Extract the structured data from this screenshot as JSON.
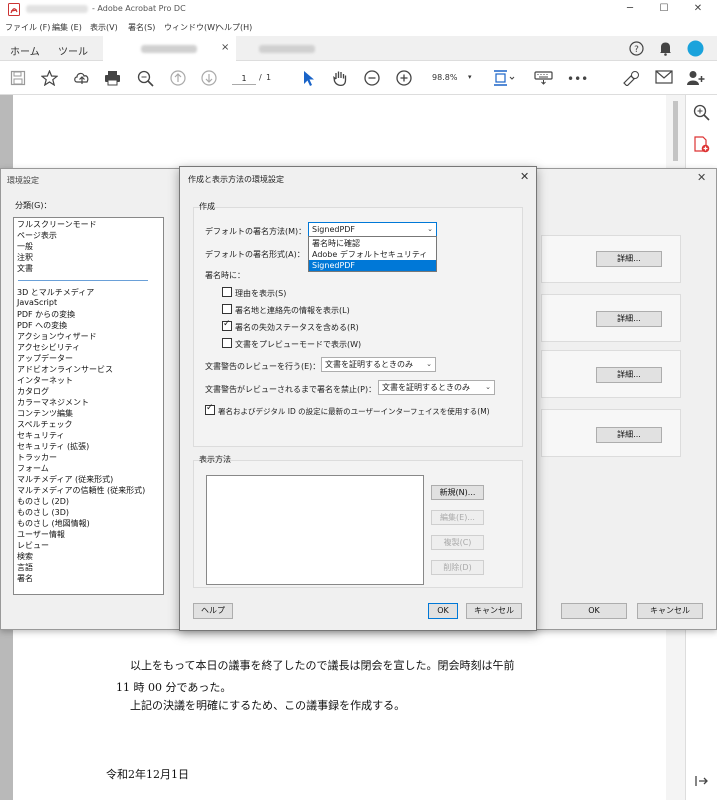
{
  "window": {
    "app_name": "- Adobe Acrobat Pro DC",
    "minimize": "─",
    "maximize": "☐",
    "close": "✕"
  },
  "menu": [
    "ファイル (F)",
    "編集 (E)",
    "表示(V)",
    "署名(S)",
    "ウィンドウ(W)",
    "ヘルプ(H)"
  ],
  "tabs": {
    "home": "ホーム",
    "tools": "ツール",
    "close": "×"
  },
  "toolbar": {
    "page_current": "1",
    "page_sep": "/",
    "page_total": "1",
    "zoom": "98.8%"
  },
  "document": {
    "lines": [
      "以上をもって本日の議事を終了したので議長は閉会を宣した。閉会時刻は午前",
      "11 時 00 分であった。",
      "上記の決議を明確にするため、この議事録を作成する。",
      "令和2年12月1日"
    ]
  },
  "preferences": {
    "title": "環境設定",
    "close": "✕",
    "category_label": "分類(G)：",
    "categories_top": [
      "フルスクリーンモード",
      "ページ表示",
      "一般",
      "注釈",
      "文書"
    ],
    "categories": [
      "3D とマルチメディア",
      "JavaScript",
      "PDF からの変換",
      "PDF への変換",
      "アクションウィザード",
      "アクセシビリティ",
      "アップデーター",
      "アドビオンラインサービス",
      "インターネット",
      "カタログ",
      "カラーマネジメント",
      "コンテンツ編集",
      "スペルチェック",
      "セキュリティ",
      "セキュリティ (拡張)",
      "トラッカー",
      "フォーム",
      "マルチメディア (従来形式)",
      "マルチメディアの信頼性 (従来形式)",
      "ものさし (2D)",
      "ものさし (3D)",
      "ものさし (地図情報)",
      "ユーザー情報",
      "レビュー",
      "検索",
      "言語",
      "署名"
    ],
    "detail_button": "詳細...",
    "ok": "OK",
    "cancel": "キャンセル"
  },
  "dialog": {
    "title": "作成と表示方法の環境設定",
    "close": "✕",
    "create_group": "作成",
    "default_method_label": "デフォルトの署名方法(M)：",
    "default_method_value": "SignedPDF",
    "dropdown_options": [
      "署名時に確認",
      "Adobe デフォルトセキュリティ",
      "SignedPDF"
    ],
    "default_format_label": "デフォルトの署名形式(A)：",
    "on_signing_label": "署名時に：",
    "checkboxes": [
      {
        "label": "理由を表示(S)",
        "checked": false
      },
      {
        "label": "署名地と連絡先の情報を表示(L)",
        "checked": false
      },
      {
        "label": "署名の失効ステータスを含める(R)",
        "checked": true
      },
      {
        "label": "文書をプレビューモードで表示(W)",
        "checked": false
      }
    ],
    "review_label": "文書警告のレビューを行う(E)：",
    "review_value": "文書を証明するときのみ",
    "prevent_label": "文書警告がレビューされるまで署名を禁止(P)：",
    "prevent_value": "文書を証明するときのみ",
    "latest_ui_label": "署名およびデジタル ID の設定に最新のユーザーインターフェイスを使用する(M)",
    "latest_ui_checked": true,
    "view_group": "表示方法",
    "buttons": {
      "new": "新規(N)...",
      "edit": "編集(E)...",
      "copy": "複製(C)",
      "delete": "削除(D)"
    },
    "help": "ヘルプ",
    "ok": "OK",
    "cancel": "キャンセル"
  }
}
